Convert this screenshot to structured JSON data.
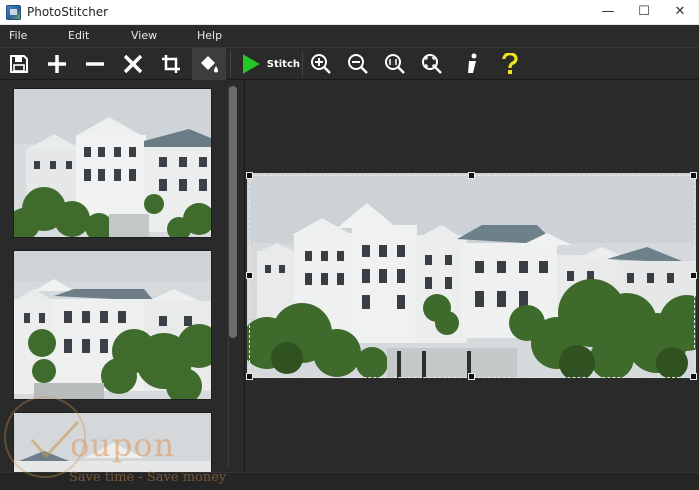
{
  "window": {
    "title": "PhotoStitcher",
    "minimize": "—",
    "maximize": "☐",
    "close": "✕"
  },
  "menu": [
    "File",
    "Edit",
    "View",
    "Help"
  ],
  "toolbar": {
    "stitch_label": "Stitch",
    "buttons": [
      "save-icon",
      "add-icon",
      "remove-icon",
      "delete-icon",
      "crop-icon",
      "fill-icon",
      "play-icon",
      "zoom-in-icon",
      "zoom-out-icon",
      "actual-size-icon",
      "fit-to-window-icon",
      "info-icon",
      "help-icon"
    ]
  },
  "colors": {
    "accent_green": "#29c629",
    "help_yellow": "#f2e11e",
    "background": "#2a2a2a",
    "menubar": "#2b2b2b"
  },
  "watermark": {
    "word": "oupon",
    "slogan": "Save time - Save money"
  },
  "thumbnails_count": 3
}
